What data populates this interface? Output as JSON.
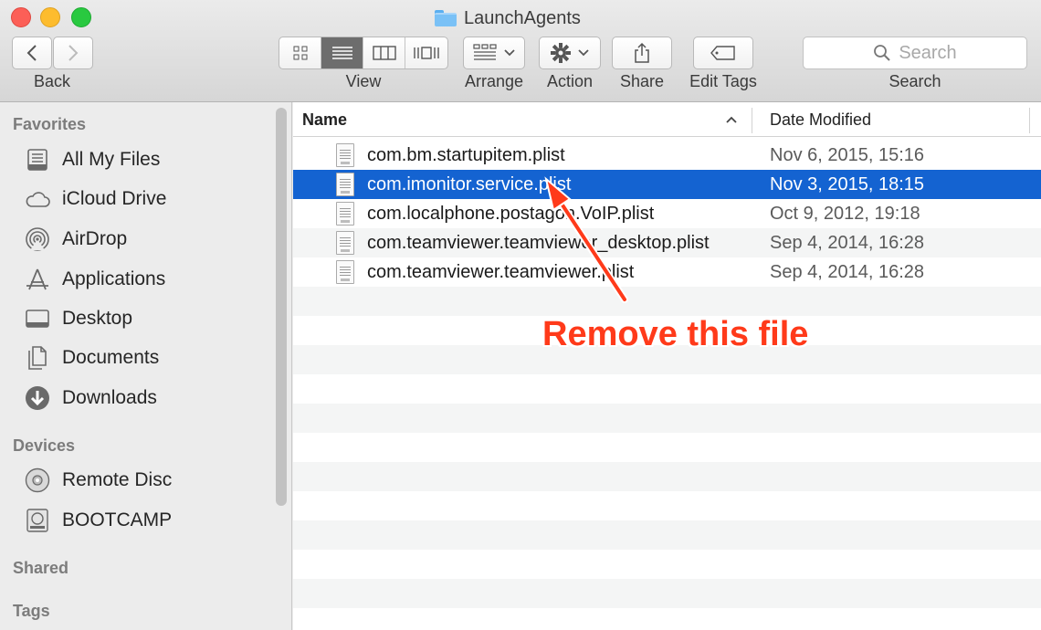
{
  "window": {
    "title": "LaunchAgents"
  },
  "toolbar": {
    "back_label": "Back",
    "view_label": "View",
    "arrange_label": "Arrange",
    "action_label": "Action",
    "share_label": "Share",
    "edit_tags_label": "Edit Tags",
    "search_label": "Search",
    "search_placeholder": "Search"
  },
  "sidebar": {
    "favorites_header": "Favorites",
    "favorites": [
      {
        "label": "All My Files",
        "icon": "all-files-icon"
      },
      {
        "label": "iCloud Drive",
        "icon": "cloud-icon"
      },
      {
        "label": "AirDrop",
        "icon": "airdrop-icon"
      },
      {
        "label": "Applications",
        "icon": "applications-icon"
      },
      {
        "label": "Desktop",
        "icon": "desktop-icon"
      },
      {
        "label": "Documents",
        "icon": "documents-icon"
      },
      {
        "label": "Downloads",
        "icon": "downloads-icon"
      }
    ],
    "devices_header": "Devices",
    "devices": [
      {
        "label": "Remote Disc",
        "icon": "disc-icon"
      },
      {
        "label": "BOOTCAMP",
        "icon": "drive-icon"
      }
    ],
    "shared_header": "Shared",
    "tags_header": "Tags"
  },
  "list": {
    "columns": {
      "name": "Name",
      "date": "Date Modified"
    },
    "sort_indicator": "^",
    "files": [
      {
        "name": "com.bm.startupitem.plist",
        "date": "Nov 6, 2015, 15:16",
        "selected": false
      },
      {
        "name": "com.imonitor.service.plist",
        "date": "Nov 3, 2015, 18:15",
        "selected": true
      },
      {
        "name": "com.localphone.postagon.VoIP.plist",
        "date": "Oct 9, 2012, 19:18",
        "selected": false
      },
      {
        "name": "com.teamviewer.teamviewer_desktop.plist",
        "date": "Sep 4, 2014, 16:28",
        "selected": false
      },
      {
        "name": "com.teamviewer.teamviewer.plist",
        "date": "Sep 4, 2014, 16:28",
        "selected": false
      }
    ]
  },
  "annotation": {
    "text": "Remove this file",
    "color": "#ff3a1a"
  },
  "colors": {
    "selection": "#1463d1",
    "accent_folder": "#7ac1f6"
  }
}
